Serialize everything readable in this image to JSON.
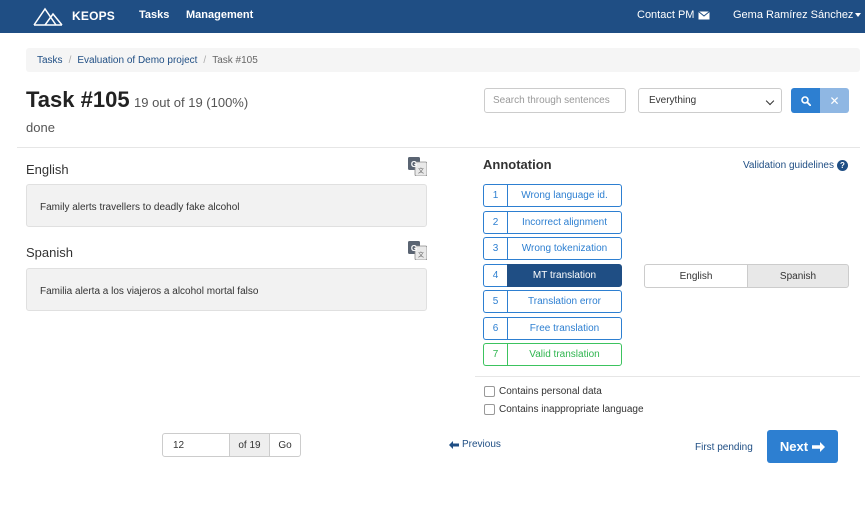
{
  "navbar": {
    "brand": "KEOPS",
    "tasks": "Tasks",
    "management": "Management",
    "contact": "Contact PM",
    "user": "Gema Ramírez Sánchez",
    "bg_color": "#1f4e84"
  },
  "breadcrumb": {
    "items": [
      "Tasks",
      "Evaluation of Demo project",
      "Task #105"
    ]
  },
  "task": {
    "title": "Task #105",
    "progress": "19 out of 19 (100%)",
    "status": "done"
  },
  "search": {
    "placeholder": "Search through sentences",
    "filter_selected": "Everything"
  },
  "sentences": {
    "source_lang": "English",
    "source_text": "Family alerts travellers to deadly fake alcohol",
    "target_lang": "Spanish",
    "target_text": "Familia alerta a los viajeros a alcohol mortal falso"
  },
  "annotation": {
    "title": "Annotation",
    "guidelines": "Validation guidelines",
    "options": [
      {
        "num": "1",
        "label": "Wrong language id."
      },
      {
        "num": "2",
        "label": "Incorrect alignment"
      },
      {
        "num": "3",
        "label": "Wrong tokenization"
      },
      {
        "num": "4",
        "label": "MT translation"
      },
      {
        "num": "5",
        "label": "Translation error"
      },
      {
        "num": "6",
        "label": "Free translation"
      },
      {
        "num": "7",
        "label": "Valid translation"
      }
    ],
    "selected": "MT translation",
    "lang_toggle": [
      "English",
      "Spanish"
    ],
    "lang_selected": "Spanish",
    "checkboxes": [
      "Contains personal data",
      "Contains inappropriate language"
    ]
  },
  "pagination": {
    "current": "12",
    "of": "of 19",
    "go": "Go",
    "previous": "Previous",
    "first_pending": "First pending",
    "next": "Next"
  },
  "colors": {
    "primary": "#2d7fd1",
    "active": "#1f4e84",
    "valid": "#3cc35f"
  }
}
